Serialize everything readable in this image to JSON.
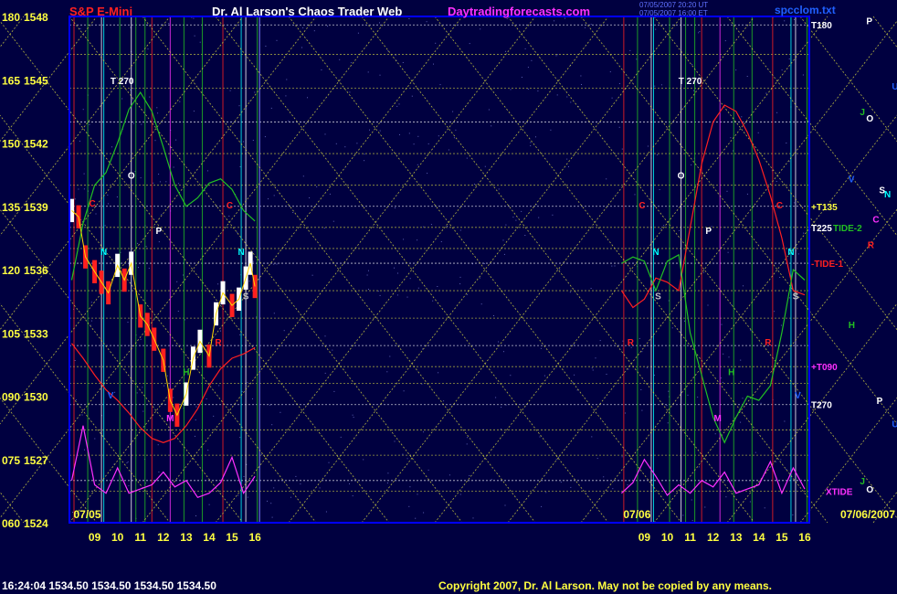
{
  "header": {
    "symbol": "S&P E-Mini",
    "title": "Dr. Al Larson's Chaos Trader Web",
    "site": "Daytradingforecasts.com",
    "stamp1": "07/05/2007 20:20 UT",
    "stamp2": "07/05/2007 16:00 ET",
    "file": "spcclom.txt"
  },
  "footer": {
    "quote": "16:24:04  1534.50  1534.50  1534.50  1534.50",
    "copyright": "Copyright 2007, Dr. Al Larson. May not be copied by any means."
  },
  "colors": {
    "background": "#000040",
    "frame": "#0000ff",
    "symbol": "#ff2020",
    "title": "#ffffff",
    "site": "#ff30ff",
    "axis_text": "#ffff40",
    "gann_lines": "#e0e040",
    "price_bar": "#ffffff",
    "down_bar": "#ff2020",
    "average": "#ffd700",
    "tide_1": "#ff2020",
    "tide_2": "#22c022",
    "xtide": "#ff30ff"
  },
  "chart_data": {
    "type": "line",
    "title": "S&P E-Mini",
    "ylim": [
      1524,
      1548
    ],
    "y_tick_labels": [
      {
        "angle": "180",
        "price": "1548"
      },
      {
        "angle": "165",
        "price": "1545"
      },
      {
        "angle": "150",
        "price": "1542"
      },
      {
        "angle": "135",
        "price": "1539"
      },
      {
        "angle": "120",
        "price": "1536"
      },
      {
        "angle": "105",
        "price": "1533"
      },
      {
        "angle": "090",
        "price": "1530"
      },
      {
        "angle": "075",
        "price": "1527"
      },
      {
        "angle": "060",
        "price": "1524"
      }
    ],
    "x_tick_labels": [
      "09",
      "10",
      "11",
      "12",
      "13",
      "14",
      "15",
      "16",
      "09",
      "10",
      "11",
      "12",
      "13",
      "14",
      "15",
      "16"
    ],
    "x_hours": [
      9,
      10,
      11,
      12,
      13,
      14,
      15,
      16,
      33,
      34,
      35,
      36,
      37,
      38,
      39,
      40
    ],
    "xlim": [
      7.9,
      40.2
    ],
    "date_labels": [
      {
        "text": "07/05",
        "hour": 8.0
      },
      {
        "text": "07/06",
        "hour": 32.0
      },
      {
        "text": "07/06/2007",
        "hour": 40.2
      }
    ],
    "right_labels": [
      {
        "text": "T180",
        "price": 1547.6,
        "color": "#ffffff"
      },
      {
        "text": "+T135",
        "price": 1539.0,
        "color": "#ffff40"
      },
      {
        "text": "T225",
        "price": 1538.0,
        "color": "#ffffff"
      },
      {
        "text": "TIDE-2",
        "price": 1538.0,
        "color": "#22c022"
      },
      {
        "text": "-TIDE-1",
        "price": 1536.3,
        "color": "#ff2020"
      },
      {
        "text": "+T090",
        "price": 1531.4,
        "color": "#ff30ff"
      },
      {
        "text": "T270",
        "price": 1529.6,
        "color": "#ffffff"
      },
      {
        "text": "XTIDE",
        "price": 1525.5,
        "color": "#ff30ff"
      }
    ],
    "planet_glyphs": [
      {
        "text": "P",
        "price": 1547.8,
        "color": "#ffffff",
        "col": 0.6
      },
      {
        "text": "U",
        "price": 1544.7,
        "color": "#2060ff",
        "col": 2.6
      },
      {
        "text": "J",
        "price": 1543.5,
        "color": "#22c022",
        "col": 0.1
      },
      {
        "text": "O",
        "price": 1543.2,
        "color": "#ffffff",
        "col": 0.6
      },
      {
        "text": "V",
        "price": 1540.3,
        "color": "#2060ff",
        "col": -0.8
      },
      {
        "text": "S",
        "price": 1539.8,
        "color": "#ffffff",
        "col": 1.6
      },
      {
        "text": "N",
        "price": 1539.6,
        "color": "#00ffff",
        "col": 2.0
      },
      {
        "text": "C",
        "price": 1538.4,
        "color": "#ff30ff",
        "col": 1.1
      },
      {
        "text": "R",
        "price": 1537.2,
        "color": "#ff2020",
        "col": 0.7
      },
      {
        "text": "H",
        "price": 1533.4,
        "color": "#22c022",
        "col": -0.8
      },
      {
        "text": "P",
        "price": 1529.8,
        "color": "#ffffff",
        "col": 1.4
      },
      {
        "text": "U",
        "price": 1528.7,
        "color": "#2060ff",
        "col": 2.6
      },
      {
        "text": "J",
        "price": 1526.0,
        "color": "#22c022",
        "col": 0.1
      },
      {
        "text": "O",
        "price": 1525.6,
        "color": "#ffffff",
        "col": 0.6
      }
    ],
    "annotations": [
      {
        "text": "T 270",
        "hour": 10.2,
        "price": 1544.8,
        "color": "#ffffff"
      },
      {
        "text": "T 270",
        "hour": 35.0,
        "price": 1544.8,
        "color": "#ffffff"
      },
      {
        "text": "O",
        "hour": 10.6,
        "price": 1540.3,
        "color": "#ffffff"
      },
      {
        "text": "O",
        "hour": 34.6,
        "price": 1540.3,
        "color": "#ffffff"
      },
      {
        "text": "C",
        "hour": 8.9,
        "price": 1539.0,
        "color": "#ff2020"
      },
      {
        "text": "C",
        "hour": 14.9,
        "price": 1538.9,
        "color": "#ff2020"
      },
      {
        "text": "C",
        "hour": 32.9,
        "price": 1538.9,
        "color": "#ff2020"
      },
      {
        "text": "C",
        "hour": 38.9,
        "price": 1538.9,
        "color": "#ff2020"
      },
      {
        "text": "P",
        "hour": 11.8,
        "price": 1537.7,
        "color": "#ffffff"
      },
      {
        "text": "P",
        "hour": 35.8,
        "price": 1537.7,
        "color": "#ffffff"
      },
      {
        "text": "N",
        "hour": 9.4,
        "price": 1536.7,
        "color": "#00ffff"
      },
      {
        "text": "N",
        "hour": 15.4,
        "price": 1536.7,
        "color": "#00ffff"
      },
      {
        "text": "N",
        "hour": 33.5,
        "price": 1536.7,
        "color": "#00ffff"
      },
      {
        "text": "N",
        "hour": 39.4,
        "price": 1536.7,
        "color": "#00ffff"
      },
      {
        "text": "S",
        "hour": 15.6,
        "price": 1534.6,
        "color": "#c0c0c0"
      },
      {
        "text": "S",
        "hour": 33.6,
        "price": 1534.6,
        "color": "#c0c0c0"
      },
      {
        "text": "S",
        "hour": 39.6,
        "price": 1534.6,
        "color": "#c0c0c0"
      },
      {
        "text": "R",
        "hour": 14.4,
        "price": 1532.4,
        "color": "#ff2020"
      },
      {
        "text": "R",
        "hour": 32.4,
        "price": 1532.4,
        "color": "#ff2020"
      },
      {
        "text": "R",
        "hour": 38.4,
        "price": 1532.4,
        "color": "#ff2020"
      },
      {
        "text": "H",
        "hour": 13.0,
        "price": 1531.0,
        "color": "#22c022"
      },
      {
        "text": "H",
        "hour": 36.8,
        "price": 1531.0,
        "color": "#22c022"
      },
      {
        "text": "V",
        "hour": 9.7,
        "price": 1529.9,
        "color": "#2060ff"
      },
      {
        "text": "V",
        "hour": 39.7,
        "price": 1529.9,
        "color": "#2060ff"
      },
      {
        "text": "M",
        "hour": 12.3,
        "price": 1528.8,
        "color": "#ff30ff"
      },
      {
        "text": "M",
        "hour": 36.2,
        "price": 1528.8,
        "color": "#ff30ff"
      }
    ],
    "series": [
      {
        "name": "TIDE-1",
        "color": "#ff2020",
        "x": [
          8.0,
          8.5,
          9,
          9.5,
          10,
          10.5,
          11,
          11.5,
          12,
          12.5,
          13,
          13.5,
          14,
          14.5,
          15,
          15.5,
          16,
          32,
          32.5,
          33,
          33.5,
          34,
          34.5,
          35,
          35.5,
          36,
          36.5,
          37,
          37.5,
          38,
          38.5,
          39,
          39.5,
          40
        ],
        "y": [
          1532.5,
          1531.8,
          1531.0,
          1530.3,
          1529.8,
          1529.2,
          1528.5,
          1528.0,
          1527.8,
          1528.0,
          1528.6,
          1529.4,
          1530.5,
          1531.3,
          1531.8,
          1532.0,
          1532.3,
          1535.0,
          1534.2,
          1534.6,
          1535.6,
          1535.4,
          1535.0,
          1538.0,
          1541.0,
          1543.0,
          1543.8,
          1543.5,
          1542.5,
          1541.2,
          1539.5,
          1537.5,
          1535.0,
          1534.8
        ]
      },
      {
        "name": "TIDE-2",
        "color": "#22c022",
        "x": [
          8.0,
          8.5,
          9,
          9.5,
          10,
          10.5,
          11,
          11.5,
          12,
          12.5,
          13,
          13.5,
          14,
          14.5,
          15,
          15.5,
          16,
          32,
          32.5,
          33,
          33.5,
          34,
          34.5,
          35,
          35.5,
          36,
          36.5,
          37,
          37.5,
          38,
          38.5,
          39,
          39.5,
          40
        ],
        "y": [
          1535.5,
          1538.2,
          1540.0,
          1540.6,
          1542.0,
          1543.6,
          1544.4,
          1543.5,
          1541.8,
          1540.0,
          1539.0,
          1539.4,
          1540.1,
          1540.3,
          1539.8,
          1538.8,
          1538.3,
          1536.3,
          1536.6,
          1536.4,
          1535.0,
          1536.4,
          1536.7,
          1533.0,
          1531.0,
          1529.0,
          1527.8,
          1529.0,
          1530.0,
          1529.8,
          1530.5,
          1533.0,
          1536.0,
          1535.5
        ]
      },
      {
        "name": "XTIDE",
        "color": "#ff30ff",
        "x": [
          8.0,
          8.5,
          9,
          9.5,
          10,
          10.5,
          11,
          11.5,
          12,
          12.5,
          13,
          13.5,
          14,
          14.5,
          15,
          15.5,
          16,
          32,
          32.5,
          33,
          33.5,
          34,
          34.5,
          35,
          35.5,
          36,
          36.5,
          37,
          37.5,
          38,
          38.5,
          39,
          39.5,
          40
        ],
        "y": [
          1526.0,
          1528.6,
          1525.8,
          1525.4,
          1526.6,
          1525.4,
          1525.6,
          1525.8,
          1526.4,
          1525.7,
          1526.0,
          1525.2,
          1525.4,
          1525.9,
          1527.1,
          1525.4,
          1526.2,
          1525.4,
          1525.9,
          1527.0,
          1526.2,
          1525.3,
          1525.8,
          1525.4,
          1526.0,
          1525.7,
          1526.4,
          1525.4,
          1525.6,
          1525.8,
          1526.9,
          1525.4,
          1526.6,
          1525.6
        ]
      },
      {
        "name": "Price",
        "color": "#ffffff",
        "x": [
          8.0,
          8.3,
          8.6,
          9.0,
          9.3,
          9.6,
          10.0,
          10.3,
          10.6,
          11.0,
          11.3,
          11.6,
          12.0,
          12.3,
          12.6,
          13.0,
          13.3,
          13.6,
          14.0,
          14.3,
          14.6,
          15.0,
          15.3,
          15.6,
          15.8,
          16.0
        ],
        "y": [
          1538.8,
          1538.5,
          1536.6,
          1535.9,
          1535.4,
          1534.9,
          1536.2,
          1535.5,
          1536.3,
          1533.8,
          1533.4,
          1532.7,
          1531.7,
          1529.8,
          1529.1,
          1530.1,
          1531.8,
          1532.6,
          1531.9,
          1533.9,
          1534.9,
          1534.3,
          1534.6,
          1535.6,
          1536.3,
          1535.2
        ]
      }
    ]
  }
}
